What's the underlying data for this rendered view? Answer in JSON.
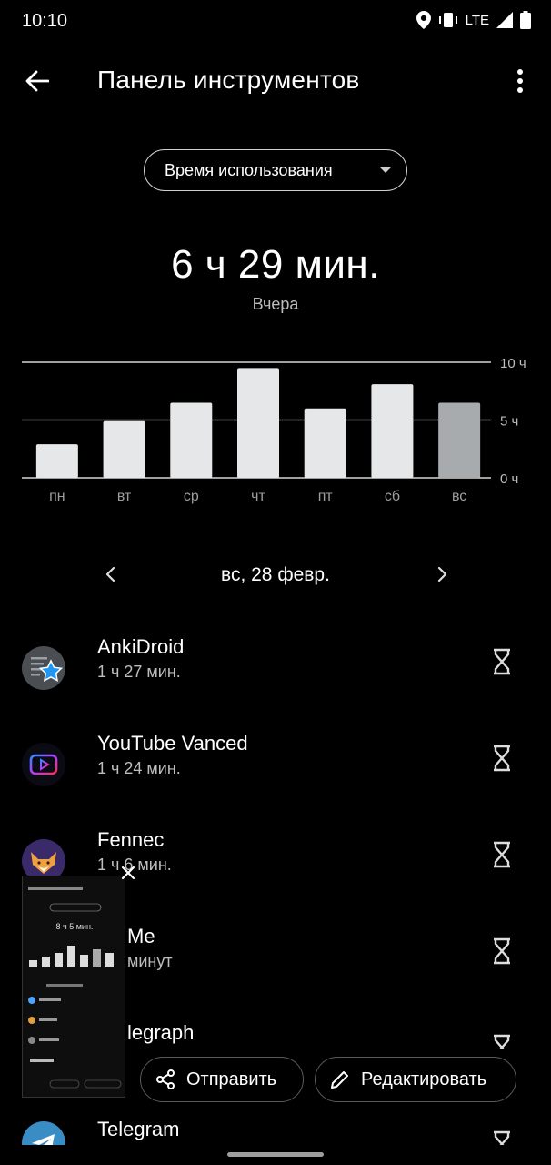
{
  "status_bar": {
    "time": "10:10",
    "network": "LTE",
    "icons": [
      "location-icon",
      "vibrate-icon",
      "signal-icon",
      "battery-icon"
    ]
  },
  "app_bar": {
    "title": "Панель инструментов",
    "back_icon": "arrow-back-icon",
    "menu_icon": "more-vert-icon"
  },
  "dropdown": {
    "selected": "Время использования"
  },
  "summary": {
    "total": "6 ч 29 мин.",
    "subtitle": "Вчера"
  },
  "chart_data": {
    "type": "bar",
    "categories": [
      "пн",
      "вт",
      "ср",
      "чт",
      "пт",
      "сб",
      "вс"
    ],
    "values": [
      2.9,
      4.9,
      6.5,
      9.5,
      6.0,
      8.1,
      6.5
    ],
    "y_ticks": [
      "10 ч",
      "5 ч",
      "0 ч"
    ],
    "y_tick_values": [
      10,
      5,
      0
    ],
    "ylim": [
      0,
      10
    ],
    "selected_index": 6,
    "bar_color": "#e6e7e8",
    "selected_color": "#a7abae",
    "gridline_color": "#ffffff",
    "grid": true
  },
  "date_nav": {
    "label": "вс, 28 февр."
  },
  "apps": [
    {
      "name": "AnkiDroid",
      "time": "1 ч 27 мин.",
      "icon": "ankidroid-icon"
    },
    {
      "name": "YouTube Vanced",
      "time": "1 ч 24 мин.",
      "icon": "youtube-vanced-icon"
    },
    {
      "name": "Fennec",
      "time": "1 ч 6 мин.",
      "icon": "fennec-icon"
    },
    {
      "name": "Me",
      "time": "минут",
      "icon": "app-icon"
    },
    {
      "name": "legraph",
      "time": "",
      "icon": "app-icon"
    },
    {
      "name": "Telegram",
      "time": "",
      "icon": "telegram-icon"
    }
  ],
  "actions": {
    "send": "Отправить",
    "edit": "Редактировать"
  },
  "thumbnail": {
    "total": "8 ч 5 мин."
  }
}
